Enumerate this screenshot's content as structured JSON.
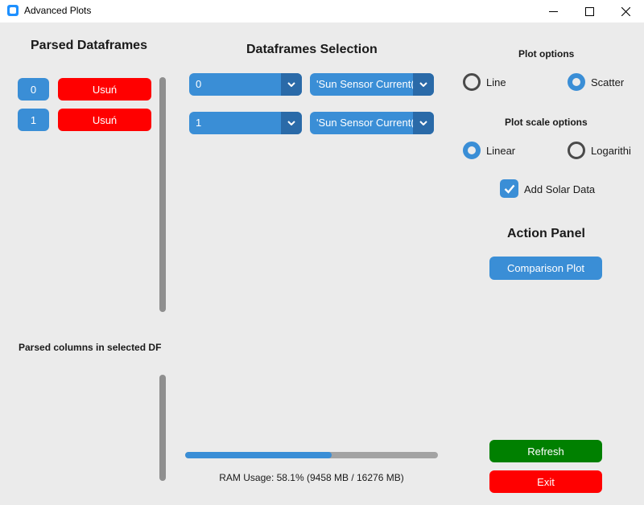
{
  "window": {
    "title": "Advanced Plots",
    "minimize_glyph": "—",
    "maximize_glyph": "☐",
    "close_glyph": "✕"
  },
  "left_panel": {
    "heading": "Parsed Dataframes",
    "dataframes": [
      {
        "index": "0",
        "remove_label": "Usuń"
      },
      {
        "index": "1",
        "remove_label": "Usuń"
      }
    ],
    "columns_heading": "Parsed columns in selected DF"
  },
  "middle_panel": {
    "heading": "Dataframes Selection",
    "rows": [
      {
        "dataframe": "0",
        "column": "'Sun Sensor Current(("
      },
      {
        "dataframe": "1",
        "column": "'Sun Sensor Current(("
      }
    ],
    "ram_usage_text": "RAM Usage: 58.1% (9458 MB / 16276 MB)",
    "ram_usage_fraction": 0.581
  },
  "right_panel": {
    "plot_options_heading": "Plot options",
    "plot_options": [
      {
        "label": "Line",
        "selected": false
      },
      {
        "label": "Scatter",
        "selected": true
      }
    ],
    "scale_options_heading": "Plot scale options",
    "scale_options": [
      {
        "label": "Linear",
        "selected": true
      },
      {
        "label": "Logarithi",
        "selected": false
      }
    ],
    "solar_checkbox": {
      "label": "Add Solar Data",
      "checked": true
    },
    "action_heading": "Action Panel",
    "comparison_button": "Comparison Plot",
    "refresh_button": "Refresh",
    "exit_button": "Exit"
  },
  "colors": {
    "accent": "#3a8ed6",
    "danger": "#ff0000",
    "success": "#008000",
    "background": "#ebebeb"
  }
}
